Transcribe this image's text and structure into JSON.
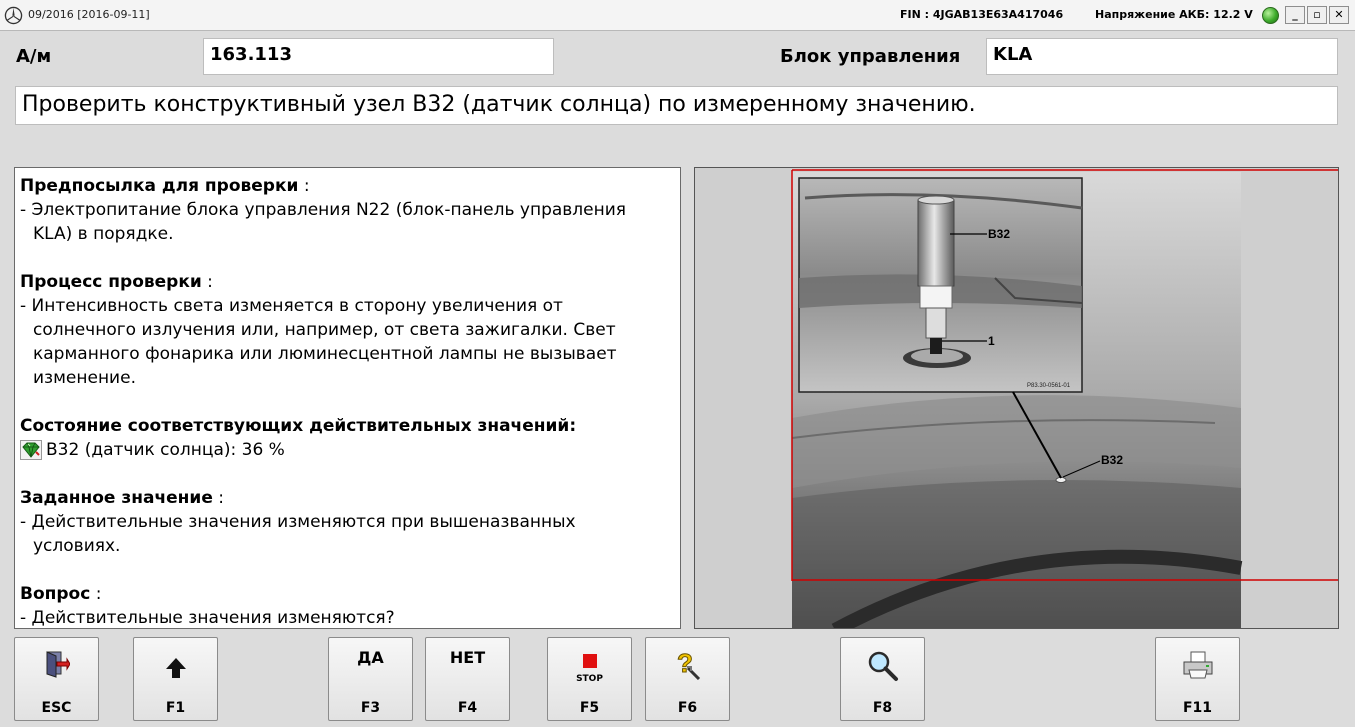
{
  "titlebar": {
    "version": "09/2016 [2016-09-11]",
    "fin": "FIN : 4JGAB13E63A417046",
    "battery": "Напряжение АКБ: 12.2 V",
    "status_color": "#3dab2b",
    "icons": [
      "mercedes-star-icon",
      "status-green-icon",
      "minimize-icon",
      "maximize-icon",
      "close-icon"
    ]
  },
  "header": {
    "vehicle_label": "А/м",
    "vehicle_value": "163.113",
    "ecu_label": "Блок управления",
    "ecu_value": "KLA",
    "instruction": "Проверить конструктивный узел B32 (датчик солнца) по измеренному значению."
  },
  "info": {
    "precondition": {
      "title": "Предпосылка для проверки",
      "colon": " :",
      "lines": [
        "- Электропитание блока управления N22 (блок-панель управления",
        "KLA) в порядке."
      ]
    },
    "process": {
      "title": "Процесс проверки",
      "colon": " :",
      "lines": [
        "- Интенсивность света изменяется в сторону увеличения от",
        "солнечного излучения или, например, от света зажигалки. Свет",
        "карманного фонарика или люминесцентной лампы не вызывает",
        "изменение."
      ]
    },
    "actual_state": {
      "title": "Состояние соответствующих действительных значений:",
      "value_icon": "green-gem-icon",
      "value": "B32 (датчик солнца): 36 %"
    },
    "target": {
      "title": "Заданное значение",
      "colon": " :",
      "lines": [
        "- Действительные значения изменяются при вышеназванных",
        "условиях."
      ]
    },
    "question": {
      "title": "Вопрос",
      "colon": " :",
      "lines": [
        "- Действительные значения изменяются?"
      ]
    }
  },
  "figure": {
    "callout_b32_top": "B32",
    "callout_1": "1",
    "callout_b32_bottom": "B32",
    "figure_code": "P83.30-0561-01",
    "highlight_color": "#d00000"
  },
  "fkeys": {
    "esc": {
      "label": "ESC",
      "icon": "exit-door-icon"
    },
    "f1": {
      "label": "F1",
      "icon": "arrow-up-icon"
    },
    "f3": {
      "label": "F3",
      "caption": "ДА"
    },
    "f4": {
      "label": "F4",
      "caption": "НЕТ"
    },
    "f5": {
      "label": "F5",
      "caption": "STOP",
      "icon": "stop-icon"
    },
    "f6": {
      "label": "F6",
      "icon": "help-icon"
    },
    "f8": {
      "label": "F8",
      "icon": "magnifier-icon"
    },
    "f11": {
      "label": "F11",
      "icon": "printer-icon"
    }
  }
}
